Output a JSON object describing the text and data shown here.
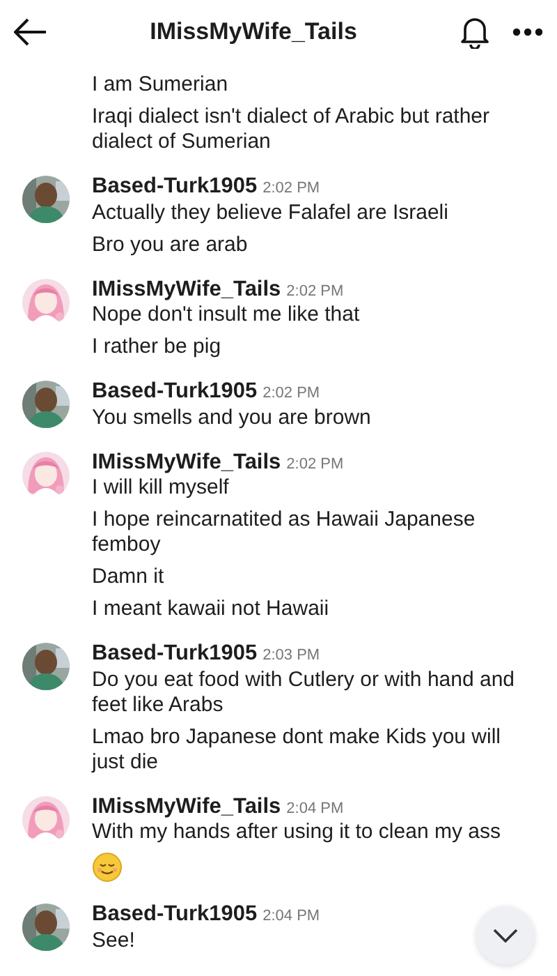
{
  "header": {
    "title": "IMissMyWife_Tails"
  },
  "groups": [
    {
      "messages": [
        {
          "kind": "text",
          "text": "I am Sumerian"
        },
        {
          "kind": "text",
          "text": "Iraqi dialect isn't dialect of Arabic but rather dialect of Sumerian"
        }
      ]
    },
    {
      "sender": "Based-Turk1905",
      "time": "2:02 PM",
      "messages": [
        {
          "kind": "text",
          "text": "Actually they believe Falafel are Israeli"
        },
        {
          "kind": "text",
          "text": "Bro you are arab"
        }
      ]
    },
    {
      "sender": "IMissMyWife_Tails",
      "time": "2:02 PM",
      "messages": [
        {
          "kind": "text",
          "text": "Nope don't insult me like that"
        },
        {
          "kind": "text",
          "text": "I rather be pig"
        }
      ]
    },
    {
      "sender": "Based-Turk1905",
      "time": "2:02 PM",
      "messages": [
        {
          "kind": "text",
          "text": "You smells and you are brown"
        }
      ]
    },
    {
      "sender": "IMissMyWife_Tails",
      "time": "2:02 PM",
      "messages": [
        {
          "kind": "text",
          "text": "I will kill myself"
        },
        {
          "kind": "text",
          "text": "I hope reincarnatited as Hawaii Japanese femboy"
        },
        {
          "kind": "text",
          "text": "Damn it"
        },
        {
          "kind": "text",
          "text": "I meant kawaii not Hawaii"
        }
      ]
    },
    {
      "sender": "Based-Turk1905",
      "time": "2:03 PM",
      "messages": [
        {
          "kind": "text",
          "text": "Do you eat food with Cutlery or with hand and feet like Arabs"
        },
        {
          "kind": "text",
          "text": "Lmao bro Japanese dont make Kids you will just die"
        }
      ]
    },
    {
      "sender": "IMissMyWife_Tails",
      "time": "2:04 PM",
      "messages": [
        {
          "kind": "text",
          "text": "With my hands after using it to clean my ass"
        },
        {
          "kind": "emoji"
        }
      ]
    },
    {
      "sender": "Based-Turk1905",
      "time": "2:04 PM",
      "messages": [
        {
          "kind": "text",
          "text": "See!"
        }
      ]
    }
  ]
}
